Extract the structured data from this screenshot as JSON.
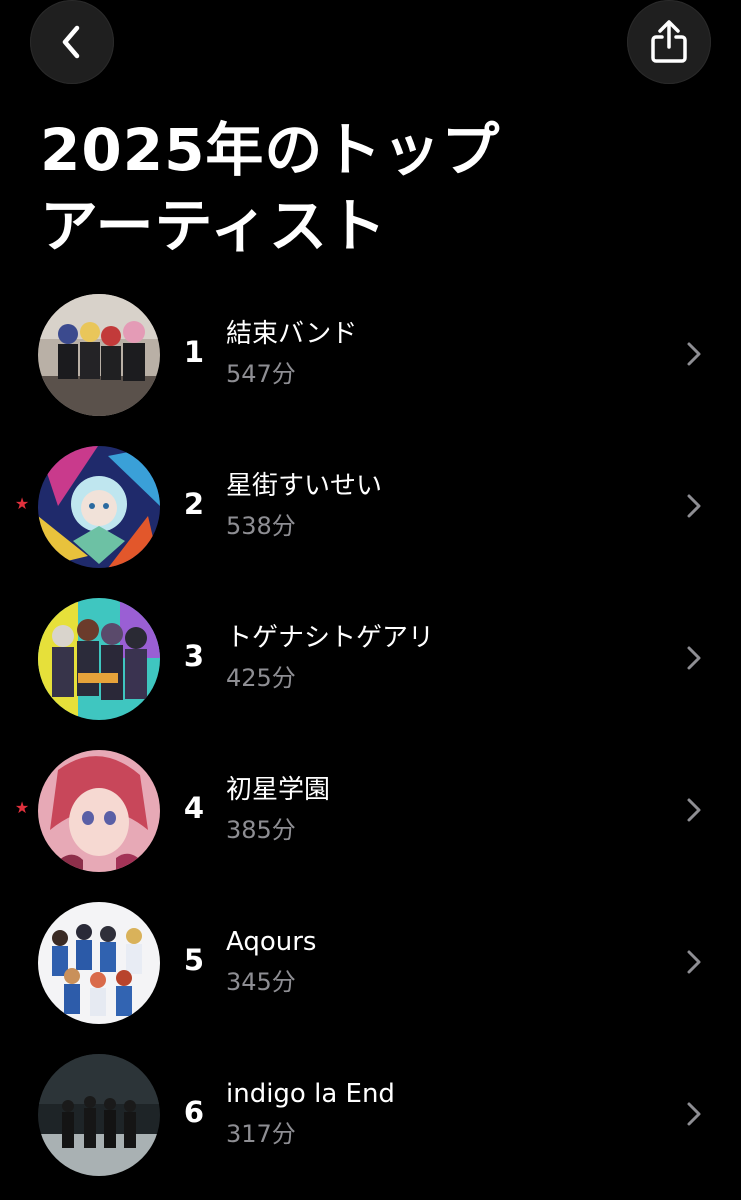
{
  "header": {
    "back_icon": "chevron-left-icon",
    "share_icon": "share-icon",
    "title_line1": "2025年のトップ",
    "title_line2": "アーティスト"
  },
  "accent_color": "#e0313d",
  "secondary_text_color": "#8e8e93",
  "artists": [
    {
      "rank": "1",
      "name": "結束バンド",
      "minutes": "547分",
      "starred": false,
      "star": ""
    },
    {
      "rank": "2",
      "name": "星街すいせい",
      "minutes": "538分",
      "starred": true,
      "star": "★"
    },
    {
      "rank": "3",
      "name": "トゲナシトゲアリ",
      "minutes": "425分",
      "starred": false,
      "star": ""
    },
    {
      "rank": "4",
      "name": "初星学園",
      "minutes": "385分",
      "starred": true,
      "star": "★"
    },
    {
      "rank": "5",
      "name": "Aqours",
      "minutes": "345分",
      "starred": false,
      "star": ""
    },
    {
      "rank": "6",
      "name": "indigo la End",
      "minutes": "317分",
      "starred": false,
      "star": ""
    }
  ]
}
